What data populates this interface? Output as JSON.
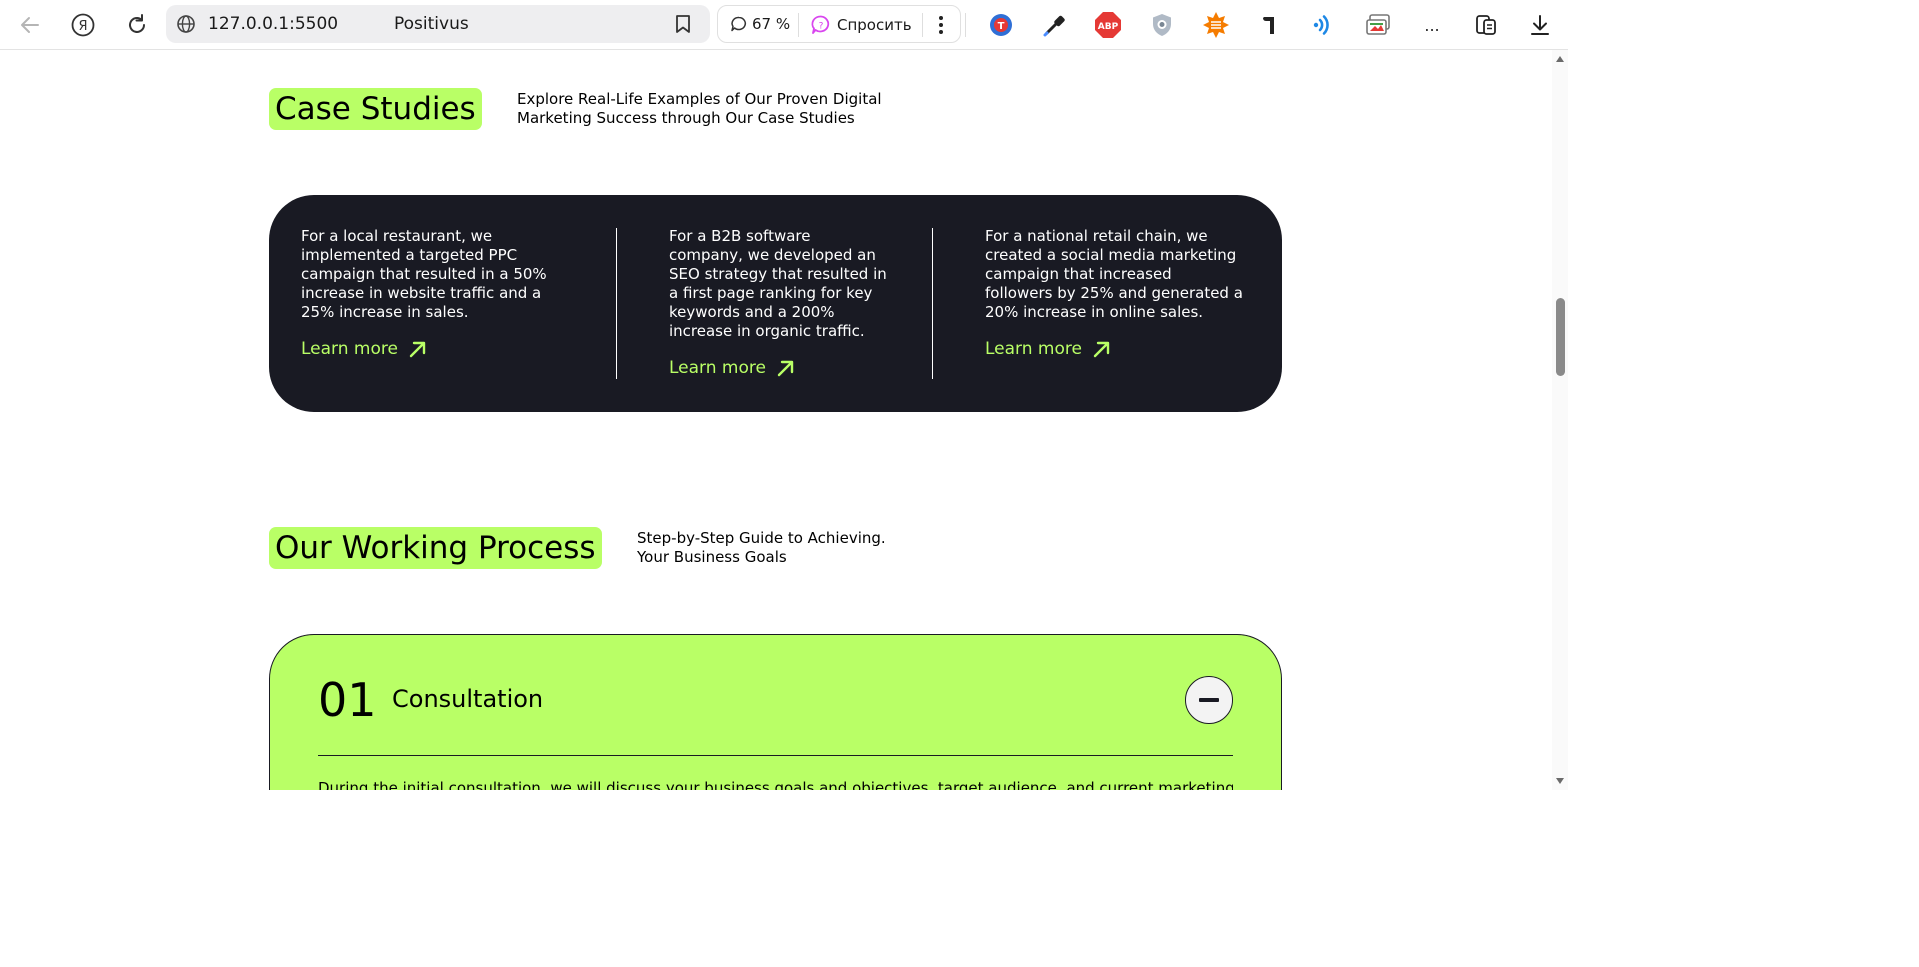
{
  "browser": {
    "url": "127.0.0.1:5500",
    "page_title": "Positivus",
    "zoom": "67 %",
    "ask_label": "Спросить",
    "more_label": "..."
  },
  "case_studies": {
    "heading": "Case Studies",
    "description": "Explore Real-Life Examples of Our Proven Digital Marketing Success through Our Case Studies",
    "items": [
      {
        "text": "For a local restaurant, we implemented a targeted PPC campaign that resulted in a 50% increase in website traffic and a 25% increase in sales.",
        "link": "Learn more"
      },
      {
        "text": "For a B2B software company, we developed an SEO strategy that resulted in a first page ranking for key keywords and a 200% increase in organic traffic.",
        "link": "Learn more"
      },
      {
        "text": "For a national retail chain, we created a social media marketing campaign that increased followers by 25% and generated a 20% increase in online sales.",
        "link": "Learn more"
      }
    ]
  },
  "working_process": {
    "heading": "Our Working Process",
    "description": "Step-by-Step Guide to Achieving. Your Business Goals",
    "steps": [
      {
        "number": "01",
        "title": "Consultation",
        "body": "During the initial consultation, we will discuss your business goals and objectives, target audience, and current marketing"
      }
    ]
  },
  "colors": {
    "accent": "#B9FF66",
    "dark": "#191A23",
    "grey": "#F3F3F3"
  },
  "icons": [
    "back-arrow-icon",
    "yandex-icon",
    "reload-icon",
    "globe-icon",
    "bookmark-icon",
    "comments-icon",
    "ask-ai-icon",
    "kebab-icon",
    "translate-ext-icon",
    "eyedropper-ext-icon",
    "adblock-ext-icon",
    "shield-ext-icon",
    "sun-ext-icon",
    "paragraph-ext-icon",
    "wifi-ext-icon",
    "screenshot-ext-icon",
    "collections-icon",
    "download-icon",
    "arrow-up-right-icon",
    "minus-icon"
  ]
}
